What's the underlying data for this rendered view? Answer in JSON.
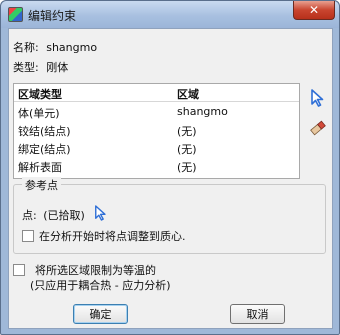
{
  "window": {
    "title": "编辑约束",
    "close_glyph": "✕"
  },
  "name": {
    "label": "名称:",
    "value": "shangmo"
  },
  "type": {
    "label": "类型:",
    "value": "刚体"
  },
  "table": {
    "headers": [
      "区域类型",
      "区域"
    ],
    "rows": [
      [
        "体(单元)",
        "shangmo"
      ],
      [
        "铰结(结点)",
        "(无)"
      ],
      [
        "绑定(结点)",
        "(无)"
      ],
      [
        "解析表面",
        "(无)"
      ]
    ]
  },
  "side_tools": [
    "select-arrow-icon",
    "eraser-icon"
  ],
  "reference_point": {
    "title": "参考点",
    "point_label": "点:",
    "point_value": "(已拾取)",
    "adjust_label": "在分析开始时将点调整到质心.",
    "adjust_checked": false
  },
  "isothermal": {
    "label_line1": "将所选区域限制为等温的",
    "label_line2": "(只应用于耦合热 - 应力分析)",
    "checked": false
  },
  "buttons": {
    "ok": "确定",
    "cancel": "取消"
  },
  "colors": {
    "titlebar": "#a8c0e0",
    "close_button": "#c9452f",
    "client_bg": "#f0f0f0",
    "accent_arrow": "#2f6fd6"
  }
}
